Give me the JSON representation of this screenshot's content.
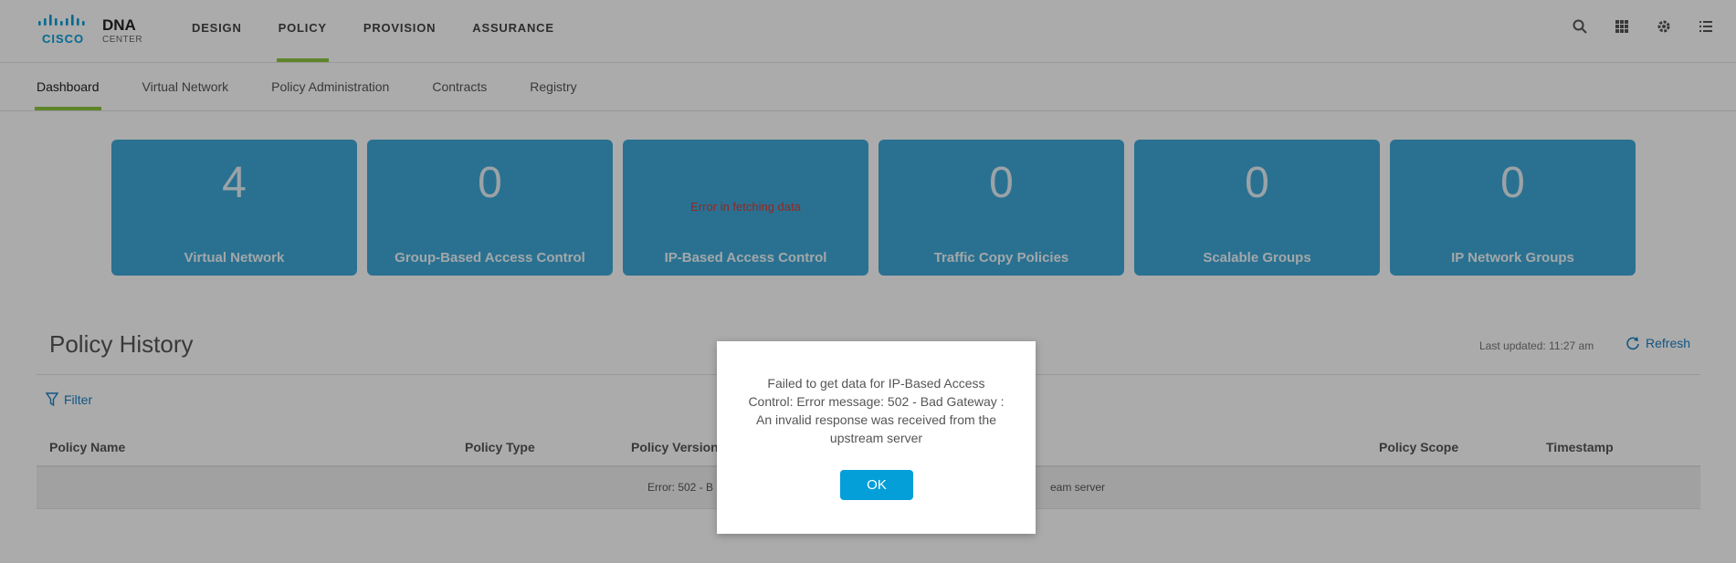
{
  "brand": {
    "line1": "DNA",
    "line2": "CENTER",
    "cisco": "CISCO",
    "color": "#049fd9"
  },
  "mainnav": [
    {
      "label": "DESIGN",
      "active": false
    },
    {
      "label": "POLICY",
      "active": true
    },
    {
      "label": "PROVISION",
      "active": false
    },
    {
      "label": "ASSURANCE",
      "active": false
    }
  ],
  "topicons": [
    "search-icon",
    "apps-grid-icon",
    "gear-icon",
    "menu-list-icon"
  ],
  "subnav": [
    {
      "label": "Dashboard",
      "active": true
    },
    {
      "label": "Virtual Network",
      "active": false
    },
    {
      "label": "Policy Administration",
      "active": false
    },
    {
      "label": "Contracts",
      "active": false
    },
    {
      "label": "Registry",
      "active": false
    }
  ],
  "cards": [
    {
      "value": "4",
      "label": "Virtual Network"
    },
    {
      "value": "0",
      "label": "Group-Based Access Control"
    },
    {
      "value": "",
      "error": "Error in fetching data",
      "label": "IP-Based Access Control"
    },
    {
      "value": "0",
      "label": "Traffic Copy Policies"
    },
    {
      "value": "0",
      "label": "Scalable Groups"
    },
    {
      "value": "0",
      "label": "IP Network Groups"
    }
  ],
  "history": {
    "title": "Policy History",
    "last_updated": "Last updated: 11:27 am",
    "refresh": "Refresh",
    "filter": "Filter",
    "columns": [
      "Policy Name",
      "Policy Type",
      "Policy Version",
      "Policy Scope",
      "Timestamp"
    ],
    "row_message_start": "Error: 502 - B",
    "row_message_end": "eam server"
  },
  "dialog": {
    "message": "Failed to get data for IP-Based Access Control: Error message: 502 - Bad Gateway : An invalid response was received from the upstream server",
    "ok": "OK"
  },
  "colors": {
    "accent_green": "#8cc63e",
    "card_blue": "#3fa9d9",
    "link_blue": "#1a80c4",
    "error_red": "#e03a2f"
  }
}
